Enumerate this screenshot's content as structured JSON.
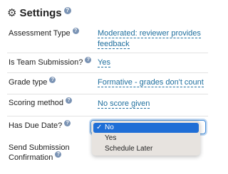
{
  "panel": {
    "title": "Settings",
    "title_icon": "gear-icon",
    "help_icon": "help-icon"
  },
  "rows": [
    {
      "label": "Assessment Type",
      "value_line1": "Moderated: reviewer provides",
      "value_line2": "feedback"
    },
    {
      "label": "Is Team Submission?",
      "value": "Yes"
    },
    {
      "label": "Grade type",
      "value": "Formative - grades don't count"
    },
    {
      "label": "Scoring method",
      "value": "No score given"
    },
    {
      "label": "Has Due Date?"
    },
    {
      "label_line1": "Send Submission",
      "label_line2": "Confirmation"
    }
  ],
  "due_date_select": {
    "selected": "No",
    "options": [
      "No",
      "Yes",
      "Schedule Later"
    ],
    "check_glyph": "✓"
  },
  "colors": {
    "link": "#1f6f9e",
    "selected_option": "#1f6ed6",
    "dropdown_bg": "#e7e3df",
    "help_icon": "#7a93b4"
  }
}
